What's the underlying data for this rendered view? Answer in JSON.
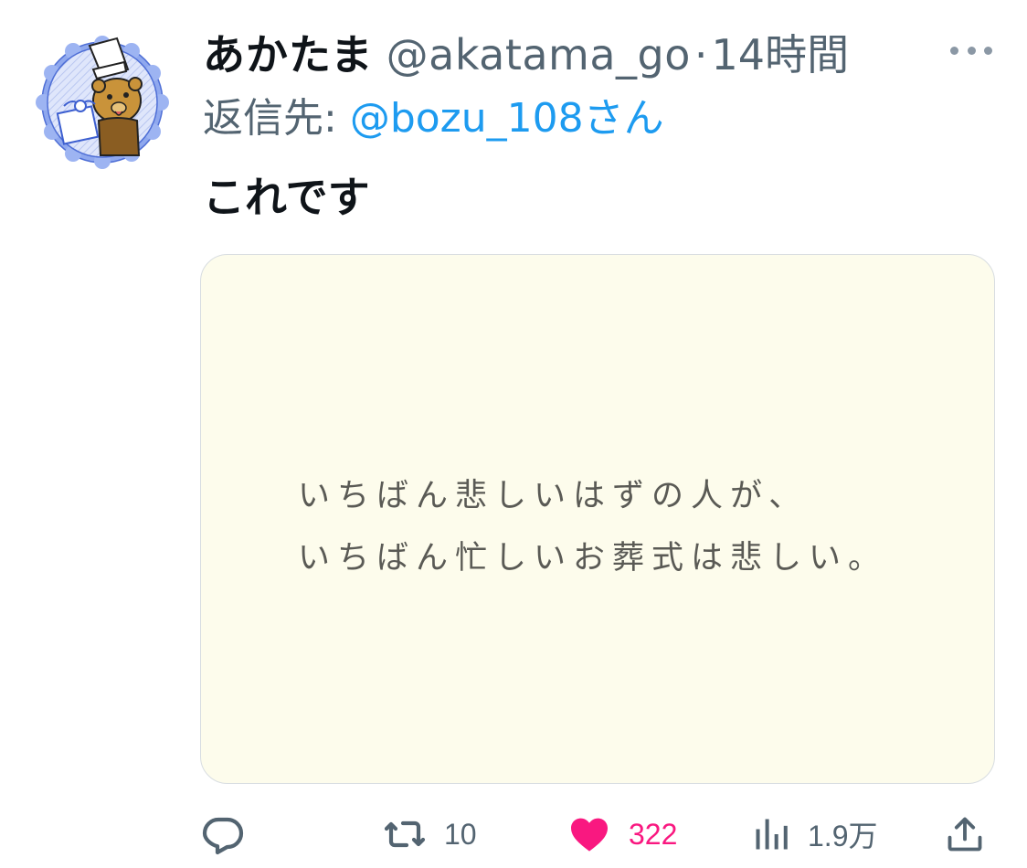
{
  "tweet": {
    "author": {
      "display_name": "あかたま",
      "handle": "@akatama_go",
      "avatar_icon": "chef-bear-avatar"
    },
    "separator": "·",
    "time": "14時間",
    "reply_to": {
      "prefix": "返信先: ",
      "mention": "@bozu_108さん"
    },
    "text": "これです",
    "media": {
      "lines": [
        "いちばん悲しいはずの人が、",
        "いちばん忙しいお葬式は悲しい。"
      ],
      "background": "#fdfcec"
    },
    "actions": {
      "reply": {
        "icon": "reply-icon",
        "count": ""
      },
      "retweet": {
        "icon": "retweet-icon",
        "count": "10"
      },
      "like": {
        "icon": "heart-icon",
        "count": "322",
        "liked": true,
        "color": "#f91880"
      },
      "views": {
        "icon": "views-icon",
        "count": "1.9万"
      },
      "share": {
        "icon": "share-icon"
      }
    },
    "colors": {
      "link": "#1d9bf0",
      "secondary": "#536471",
      "primary": "#0f1419"
    }
  }
}
